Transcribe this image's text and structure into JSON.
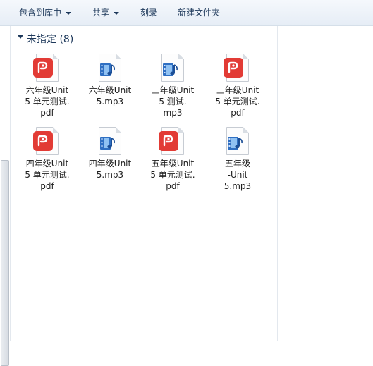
{
  "toolbar": {
    "include_label": "包含到库中",
    "share_label": "共享",
    "burn_label": "刻录",
    "new_folder_label": "新建文件夹"
  },
  "group": {
    "title": "未指定 (8)"
  },
  "files": [
    {
      "type": "pdf",
      "lines": [
        "六年级Unit",
        "5 单元测试.",
        "pdf"
      ]
    },
    {
      "type": "mp3",
      "lines": [
        "六年级Unit",
        "5.mp3"
      ]
    },
    {
      "type": "mp3",
      "lines": [
        "三年级Unit",
        "5 测试.",
        "mp3"
      ]
    },
    {
      "type": "pdf",
      "lines": [
        "三年级Unit",
        "5 单元测试.",
        "pdf"
      ]
    },
    {
      "type": "pdf",
      "lines": [
        "四年级Unit",
        "5 单元测试.",
        "pdf"
      ]
    },
    {
      "type": "mp3",
      "lines": [
        "四年级Unit",
        "5.mp3"
      ]
    },
    {
      "type": "pdf",
      "lines": [
        "五年级Unit",
        "5 单元测试.",
        "pdf"
      ]
    },
    {
      "type": "mp3",
      "lines": [
        "五年级",
        "-Unit",
        "5.mp3"
      ]
    }
  ],
  "colors": {
    "pdf_red": "#e23b35",
    "toolbar_text": "#1e395b"
  }
}
